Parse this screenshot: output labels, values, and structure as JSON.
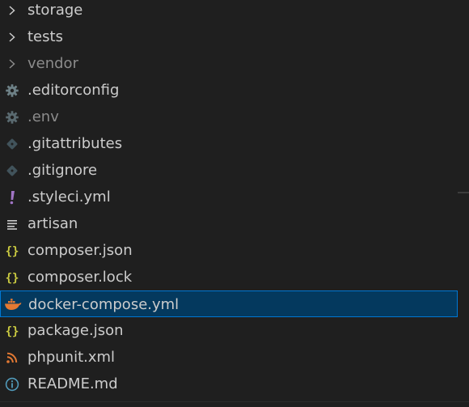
{
  "explorer": {
    "items": [
      {
        "label": "storage",
        "icon": "chevron-right-icon",
        "dimmed": false
      },
      {
        "label": "tests",
        "icon": "chevron-right-icon",
        "dimmed": false
      },
      {
        "label": "vendor",
        "icon": "chevron-right-icon",
        "dimmed": true
      },
      {
        "label": ".editorconfig",
        "icon": "gear-icon",
        "dimmed": false
      },
      {
        "label": ".env",
        "icon": "gear-icon",
        "dimmed": true
      },
      {
        "label": ".gitattributes",
        "icon": "git-icon",
        "dimmed": false
      },
      {
        "label": ".gitignore",
        "icon": "git-icon",
        "dimmed": false
      },
      {
        "label": ".styleci.yml",
        "icon": "exclamation-icon",
        "dimmed": false
      },
      {
        "label": "artisan",
        "icon": "lines-icon",
        "dimmed": false
      },
      {
        "label": "composer.json",
        "icon": "braces-icon",
        "dimmed": false
      },
      {
        "label": "composer.lock",
        "icon": "braces-icon",
        "dimmed": false
      },
      {
        "label": "docker-compose.yml",
        "icon": "docker-whale-icon",
        "dimmed": false,
        "selected": true
      },
      {
        "label": "package.json",
        "icon": "braces-icon",
        "dimmed": false
      },
      {
        "label": "phpunit.xml",
        "icon": "rss-icon",
        "dimmed": false
      },
      {
        "label": "README.md",
        "icon": "info-icon",
        "dimmed": false
      }
    ]
  },
  "colors": {
    "background": "#1f1f1f",
    "text": "#cccccc",
    "dimmed_text": "#8b8b8b",
    "selection_bg": "#04395e",
    "selection_border": "#0078d4",
    "braces": "#cbcb41",
    "exclamation": "#a074c4",
    "docker": "#e37933",
    "rss": "#e37933",
    "info": "#519aba",
    "gear": "#6d8086",
    "git": "#41535b"
  }
}
